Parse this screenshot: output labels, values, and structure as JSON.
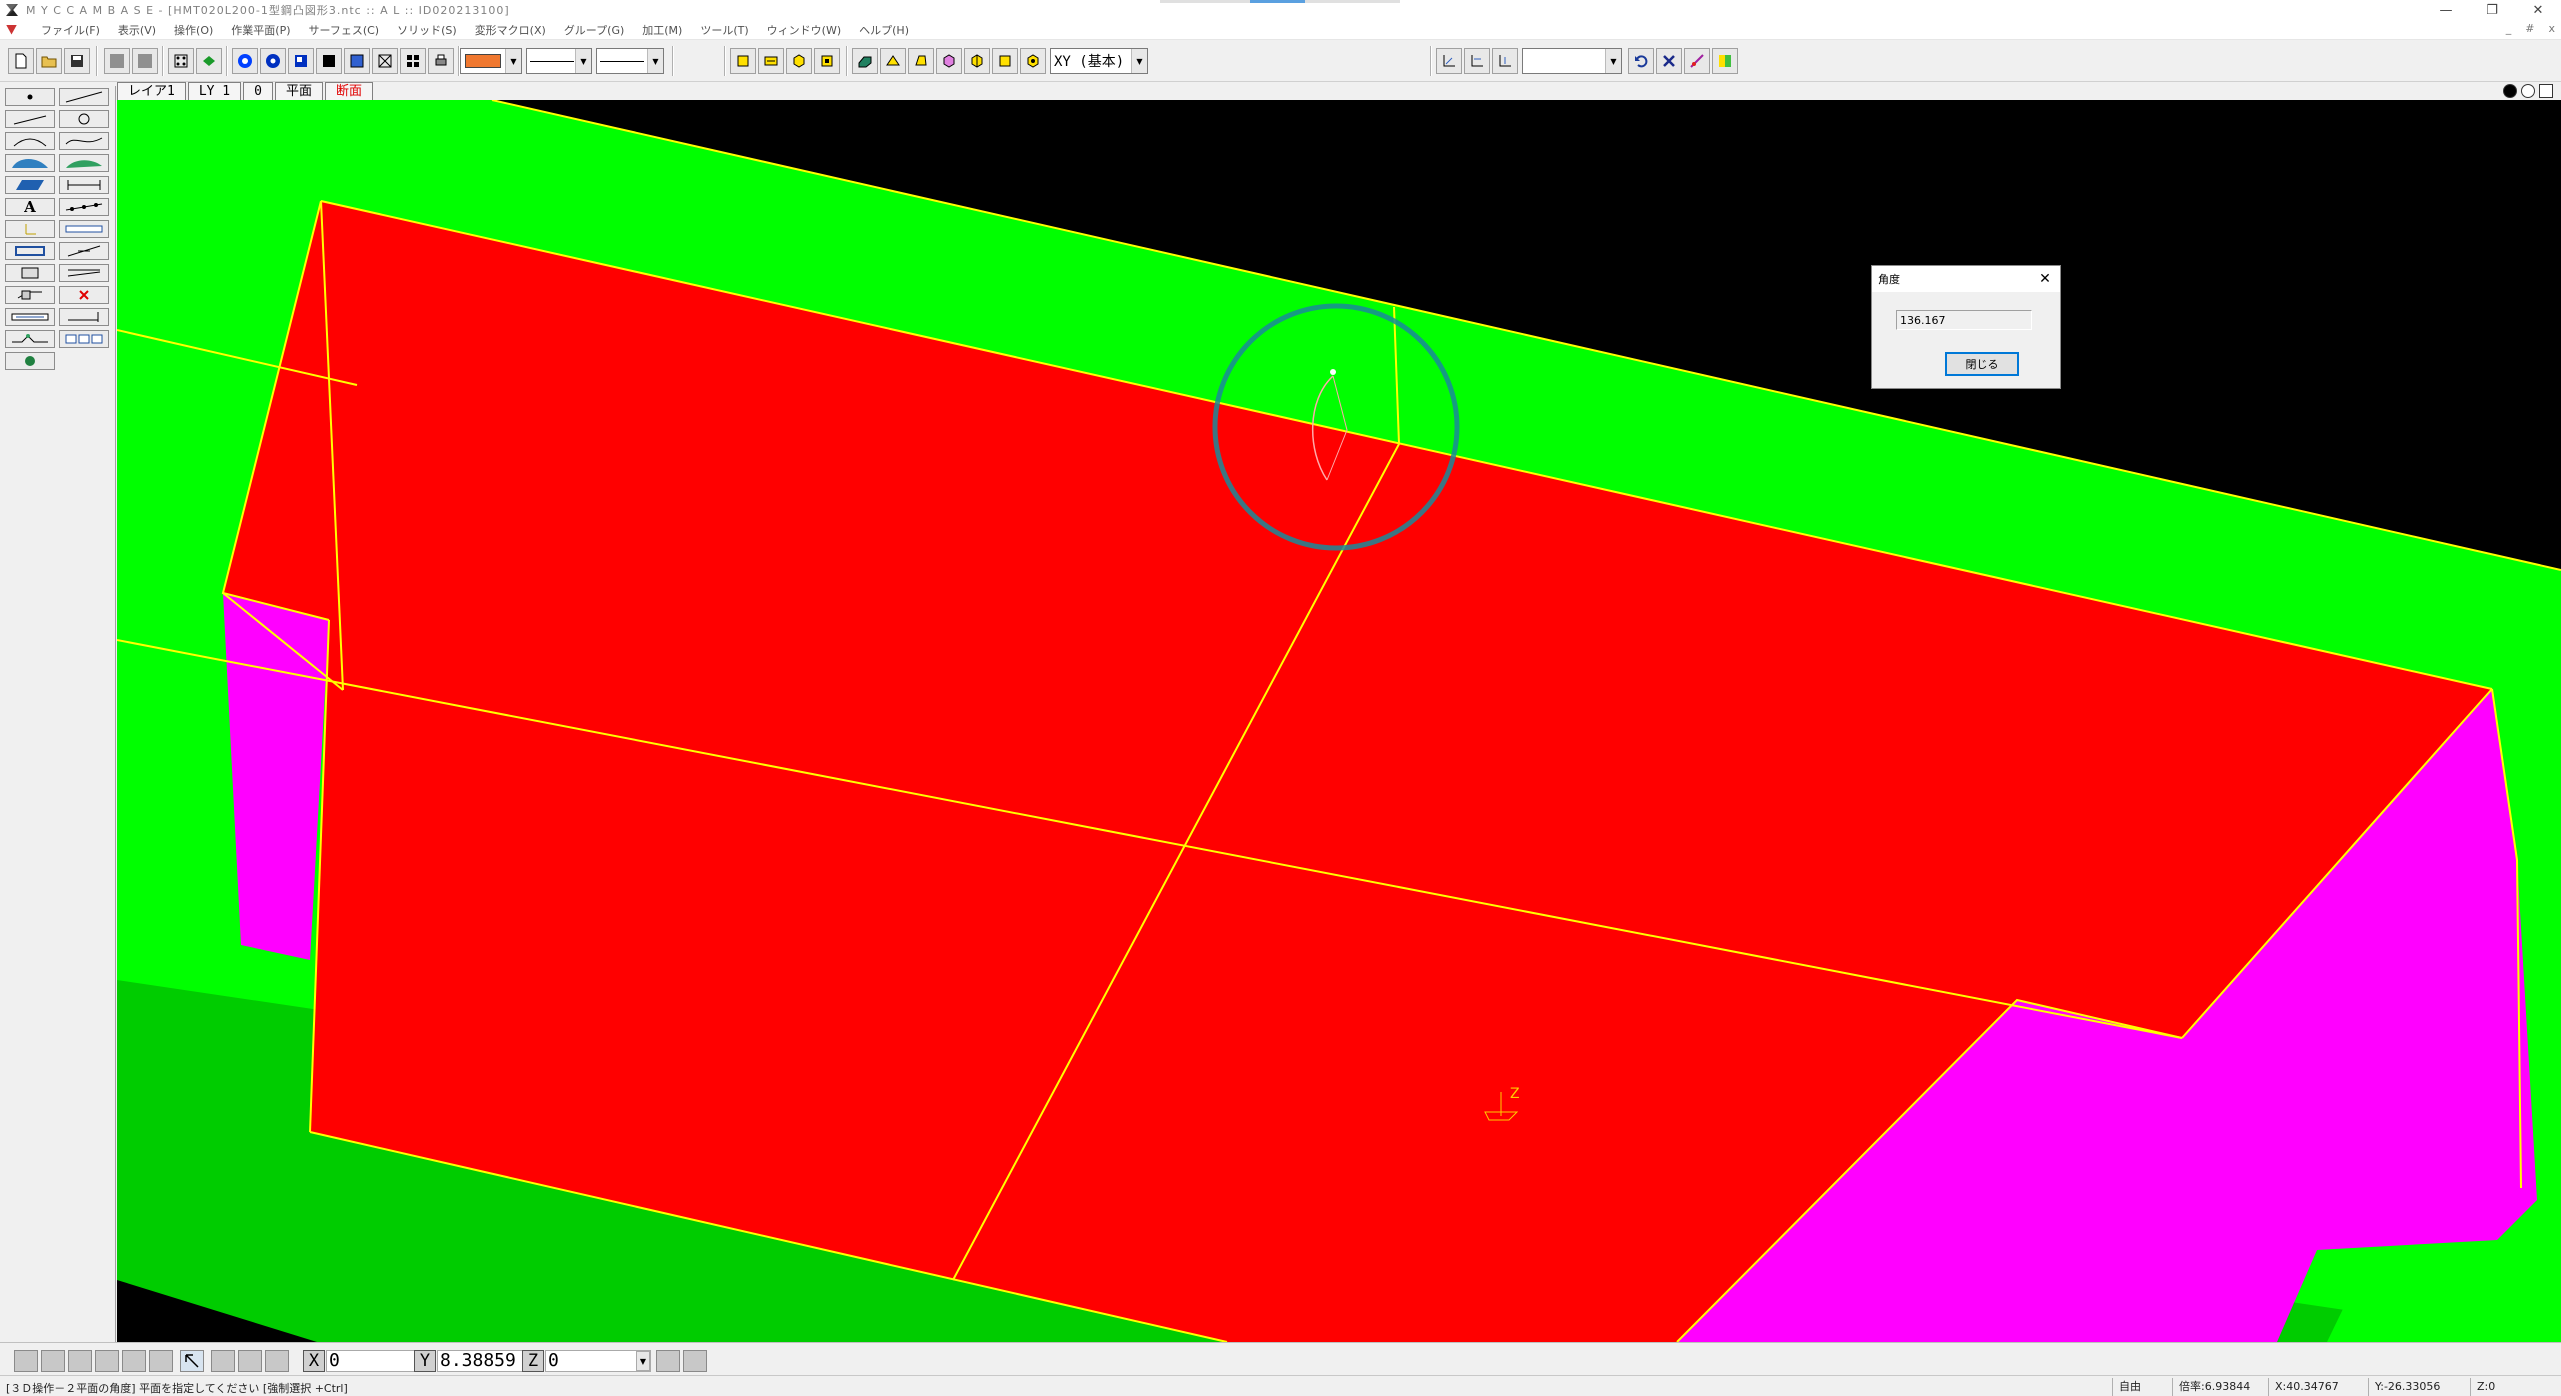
{
  "window": {
    "title": "M Y C C A M B A S E - [HMT020L200-1型鋼凸図形3.ntc :: A L :: ID020213100]",
    "controls": [
      "—",
      "❐",
      "✕"
    ],
    "mdi_controls": [
      "_",
      "#",
      "x"
    ]
  },
  "menu": {
    "items": [
      "ファイル(F)",
      "表示(V)",
      "操作(O)",
      "作業平面(P)",
      "サーフェス(C)",
      "ソリッド(S)",
      "変形マクロ(X)",
      "グループ(G)",
      "加工(M)",
      "ツール(T)",
      "ウィンドウ(W)",
      "ヘルプ(H)"
    ]
  },
  "toolbar": {
    "color_swatch": "#f07830",
    "plane_combo": "XY (基本)",
    "right_combo": ""
  },
  "tabs": {
    "items": [
      {
        "label": "レイア1",
        "color": "#000000"
      },
      {
        "label": "LY 1",
        "color": "#000000"
      },
      {
        "label": "0",
        "color": "#000000"
      },
      {
        "label": "平面",
        "color": "#000000"
      },
      {
        "label": "断面",
        "color": "#e00000"
      }
    ]
  },
  "left_tools": {
    "text_tool": "A"
  },
  "dialog": {
    "title": "角度",
    "value": "136.167",
    "close_button": "閉じる",
    "close_icon": "✕"
  },
  "coords": {
    "x_label": "X",
    "x_value": "0",
    "y_label": "Y",
    "y_value": "8.38859",
    "z_label": "Z",
    "z_value": "0"
  },
  "status": {
    "message": "[３Ｄ操作－２平面の角度] 平面を指定してください [強制選択 +Ctrl]",
    "mode": "自由",
    "scale": "倍率:6.93844",
    "x": "X:40.34767",
    "y": "Y:-26.33056",
    "z": "Z:0"
  },
  "viewport": {
    "axis_label": "Z",
    "colors": {
      "background": "#000000",
      "green": "#00ff00",
      "red": "#ff0000",
      "magenta": "#ff00ff",
      "edge": "#ffff00"
    }
  }
}
